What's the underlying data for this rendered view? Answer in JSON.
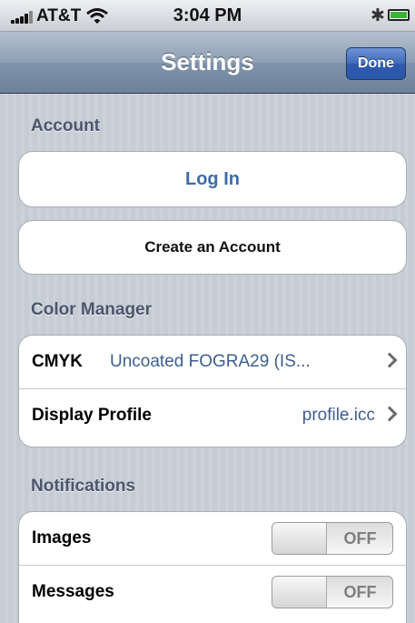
{
  "status_bar": {
    "carrier": "AT&T",
    "time": "3:04 PM",
    "icons": [
      "signal-bars-icon",
      "wifi-icon",
      "bluetooth-icon",
      "battery-charging-icon"
    ]
  },
  "nav_bar": {
    "title": "Settings",
    "done_label": "Done"
  },
  "account": {
    "header": "Account",
    "login_label": "Log In",
    "create_label": "Create an Account"
  },
  "color_manager": {
    "header": "Color Manager",
    "cmyk_label": "CMYK",
    "cmyk_value": "Uncoated FOGRA29 (IS...",
    "display_profile_label": "Display Profile",
    "display_profile_value": "profile.icc"
  },
  "notifications": {
    "header": "Notifications",
    "images_label": "Images",
    "images_state": "OFF",
    "messages_label": "Messages",
    "messages_state": "OFF"
  },
  "colors": {
    "nav_bar": "#8d9fb4",
    "done_button": "#3f6ab8",
    "link_text": "#3e6ca8",
    "value_text": "#3e5f8e",
    "section_header": "#4c566c",
    "background": "#c5ccd4"
  }
}
